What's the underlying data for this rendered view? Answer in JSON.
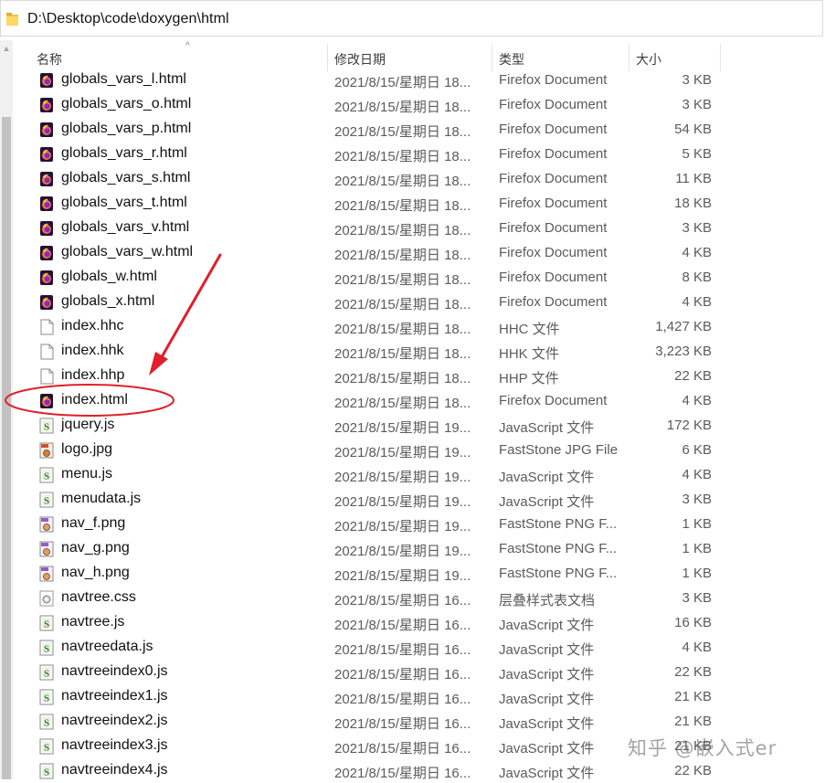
{
  "address": {
    "path": "D:\\Desktop\\code\\doxygen\\html"
  },
  "columns": {
    "name": "名称",
    "date": "修改日期",
    "type": "类型",
    "size": "大小"
  },
  "files": [
    {
      "name": "globals_vars_l.html",
      "date": "2021/8/15/星期日 18...",
      "type": "Firefox Document",
      "size": "3 KB",
      "icon": "firefox-document-icon"
    },
    {
      "name": "globals_vars_o.html",
      "date": "2021/8/15/星期日 18...",
      "type": "Firefox Document",
      "size": "3 KB",
      "icon": "firefox-document-icon"
    },
    {
      "name": "globals_vars_p.html",
      "date": "2021/8/15/星期日 18...",
      "type": "Firefox Document",
      "size": "54 KB",
      "icon": "firefox-document-icon"
    },
    {
      "name": "globals_vars_r.html",
      "date": "2021/8/15/星期日 18...",
      "type": "Firefox Document",
      "size": "5 KB",
      "icon": "firefox-document-icon"
    },
    {
      "name": "globals_vars_s.html",
      "date": "2021/8/15/星期日 18...",
      "type": "Firefox Document",
      "size": "11 KB",
      "icon": "firefox-document-icon"
    },
    {
      "name": "globals_vars_t.html",
      "date": "2021/8/15/星期日 18...",
      "type": "Firefox Document",
      "size": "18 KB",
      "icon": "firefox-document-icon"
    },
    {
      "name": "globals_vars_v.html",
      "date": "2021/8/15/星期日 18...",
      "type": "Firefox Document",
      "size": "3 KB",
      "icon": "firefox-document-icon"
    },
    {
      "name": "globals_vars_w.html",
      "date": "2021/8/15/星期日 18...",
      "type": "Firefox Document",
      "size": "4 KB",
      "icon": "firefox-document-icon"
    },
    {
      "name": "globals_w.html",
      "date": "2021/8/15/星期日 18...",
      "type": "Firefox Document",
      "size": "8 KB",
      "icon": "firefox-document-icon"
    },
    {
      "name": "globals_x.html",
      "date": "2021/8/15/星期日 18...",
      "type": "Firefox Document",
      "size": "4 KB",
      "icon": "firefox-document-icon"
    },
    {
      "name": "index.hhc",
      "date": "2021/8/15/星期日 18...",
      "type": "HHC 文件",
      "size": "1,427 KB",
      "icon": "blank-file-icon"
    },
    {
      "name": "index.hhk",
      "date": "2021/8/15/星期日 18...",
      "type": "HHK 文件",
      "size": "3,223 KB",
      "icon": "blank-file-icon"
    },
    {
      "name": "index.hhp",
      "date": "2021/8/15/星期日 18...",
      "type": "HHP 文件",
      "size": "22 KB",
      "icon": "blank-file-icon"
    },
    {
      "name": "index.html",
      "date": "2021/8/15/星期日 18...",
      "type": "Firefox Document",
      "size": "4 KB",
      "icon": "firefox-document-icon"
    },
    {
      "name": "jquery.js",
      "date": "2021/8/15/星期日 19...",
      "type": "JavaScript 文件",
      "size": "172 KB",
      "icon": "javascript-file-icon"
    },
    {
      "name": "logo.jpg",
      "date": "2021/8/15/星期日 19...",
      "type": "FastStone JPG File",
      "size": "6 KB",
      "icon": "jpg-image-icon"
    },
    {
      "name": "menu.js",
      "date": "2021/8/15/星期日 19...",
      "type": "JavaScript 文件",
      "size": "4 KB",
      "icon": "javascript-file-icon"
    },
    {
      "name": "menudata.js",
      "date": "2021/8/15/星期日 19...",
      "type": "JavaScript 文件",
      "size": "3 KB",
      "icon": "javascript-file-icon"
    },
    {
      "name": "nav_f.png",
      "date": "2021/8/15/星期日 19...",
      "type": "FastStone PNG F...",
      "size": "1 KB",
      "icon": "png-image-icon"
    },
    {
      "name": "nav_g.png",
      "date": "2021/8/15/星期日 19...",
      "type": "FastStone PNG F...",
      "size": "1 KB",
      "icon": "png-image-icon"
    },
    {
      "name": "nav_h.png",
      "date": "2021/8/15/星期日 19...",
      "type": "FastStone PNG F...",
      "size": "1 KB",
      "icon": "png-image-icon"
    },
    {
      "name": "navtree.css",
      "date": "2021/8/15/星期日 16...",
      "type": "层叠样式表文档",
      "size": "3 KB",
      "icon": "css-file-icon"
    },
    {
      "name": "navtree.js",
      "date": "2021/8/15/星期日 16...",
      "type": "JavaScript 文件",
      "size": "16 KB",
      "icon": "javascript-file-icon"
    },
    {
      "name": "navtreedata.js",
      "date": "2021/8/15/星期日 16...",
      "type": "JavaScript 文件",
      "size": "4 KB",
      "icon": "javascript-file-icon"
    },
    {
      "name": "navtreeindex0.js",
      "date": "2021/8/15/星期日 16...",
      "type": "JavaScript 文件",
      "size": "22 KB",
      "icon": "javascript-file-icon"
    },
    {
      "name": "navtreeindex1.js",
      "date": "2021/8/15/星期日 16...",
      "type": "JavaScript 文件",
      "size": "21 KB",
      "icon": "javascript-file-icon"
    },
    {
      "name": "navtreeindex2.js",
      "date": "2021/8/15/星期日 16...",
      "type": "JavaScript 文件",
      "size": "21 KB",
      "icon": "javascript-file-icon"
    },
    {
      "name": "navtreeindex3.js",
      "date": "2021/8/15/星期日 16...",
      "type": "JavaScript 文件",
      "size": "21 KB",
      "icon": "javascript-file-icon"
    },
    {
      "name": "navtreeindex4.js",
      "date": "2021/8/15/星期日 16...",
      "type": "JavaScript 文件",
      "size": "22 KB",
      "icon": "javascript-file-icon"
    }
  ],
  "annotation": {
    "highlight_color": "#e0202a",
    "circled_file": "index.html"
  },
  "watermark": {
    "text": "知乎 @嵌入式er"
  }
}
